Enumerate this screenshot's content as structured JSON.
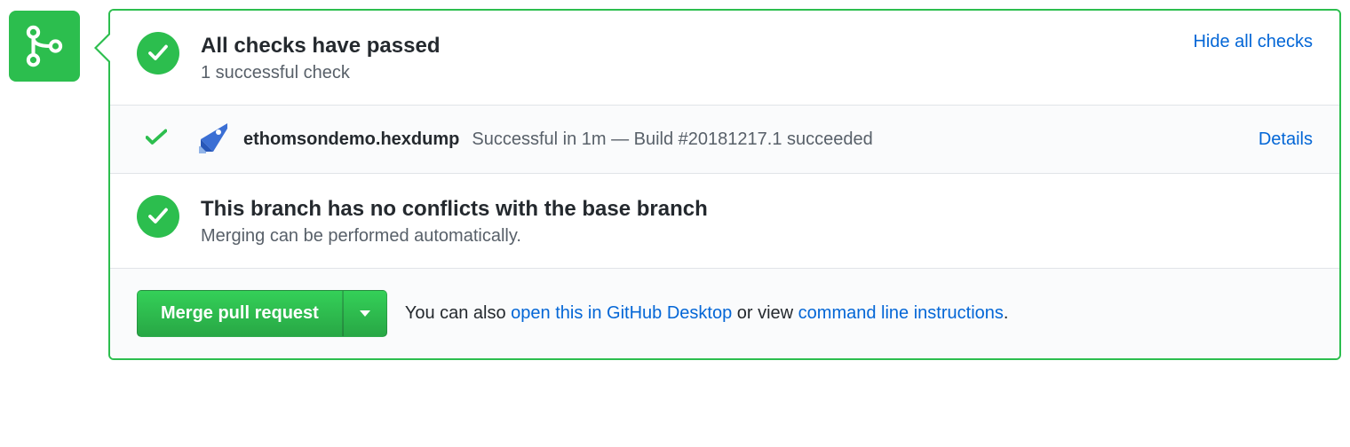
{
  "checks": {
    "title": "All checks have passed",
    "subtitle": "1 successful check",
    "toggle_label": "Hide all checks"
  },
  "check_items": [
    {
      "name": "ethomsondemo.hexdump",
      "description": "Successful in 1m — Build #20181217.1 succeeded",
      "details_label": "Details"
    }
  ],
  "conflicts": {
    "title": "This branch has no conflicts with the base branch",
    "subtitle": "Merging can be performed automatically."
  },
  "merge": {
    "button_label": "Merge pull request",
    "footer_prefix": "You can also ",
    "desktop_link": "open this in GitHub Desktop",
    "footer_middle": " or view ",
    "cli_link": "command line instructions",
    "footer_suffix": "."
  },
  "colors": {
    "success": "#2cbe4e",
    "link": "#0366d6"
  }
}
